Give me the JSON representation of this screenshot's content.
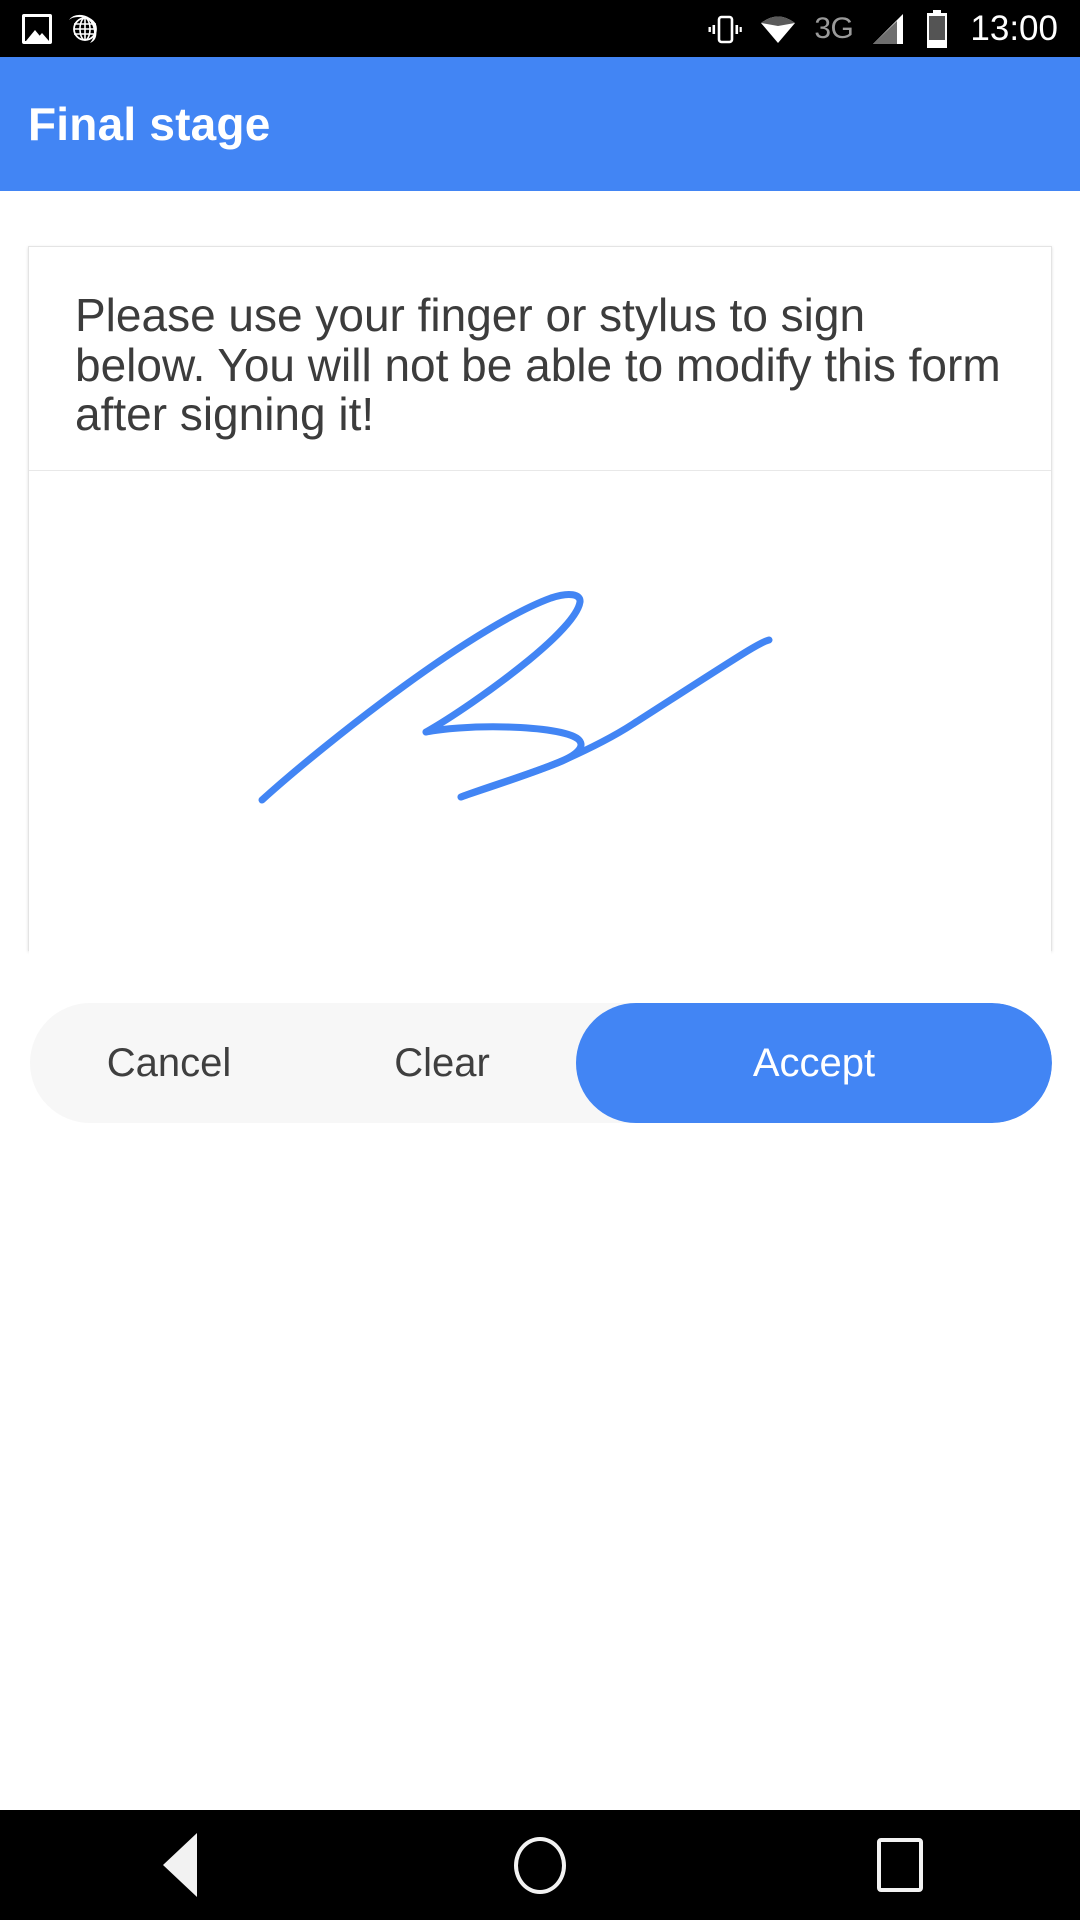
{
  "status_bar": {
    "left_icons": [
      "photo-icon",
      "globe-icon"
    ],
    "right_icons": [
      "vibrate-icon",
      "wifi-icon",
      "signal-icon",
      "battery-icon"
    ],
    "network_label": "3G",
    "time": "13:00"
  },
  "app_bar": {
    "title": "Final stage",
    "background_color": "#4285f4",
    "title_color": "#ffffff"
  },
  "card": {
    "instructions": "Please use your finger or stylus to sign below. You will not be able to modify this form after signing it!",
    "signature": {
      "present": true,
      "ink_color": "#4285f4",
      "stroke_width": 7
    }
  },
  "buttons": {
    "cancel_label": "Cancel",
    "clear_label": "Clear",
    "accept_label": "Accept",
    "accept_color": "#4285f4",
    "row_background": "#f7f7f7"
  },
  "nav_bar": {
    "back_label": "back-icon",
    "home_label": "home-icon",
    "recents_label": "recents-icon"
  }
}
